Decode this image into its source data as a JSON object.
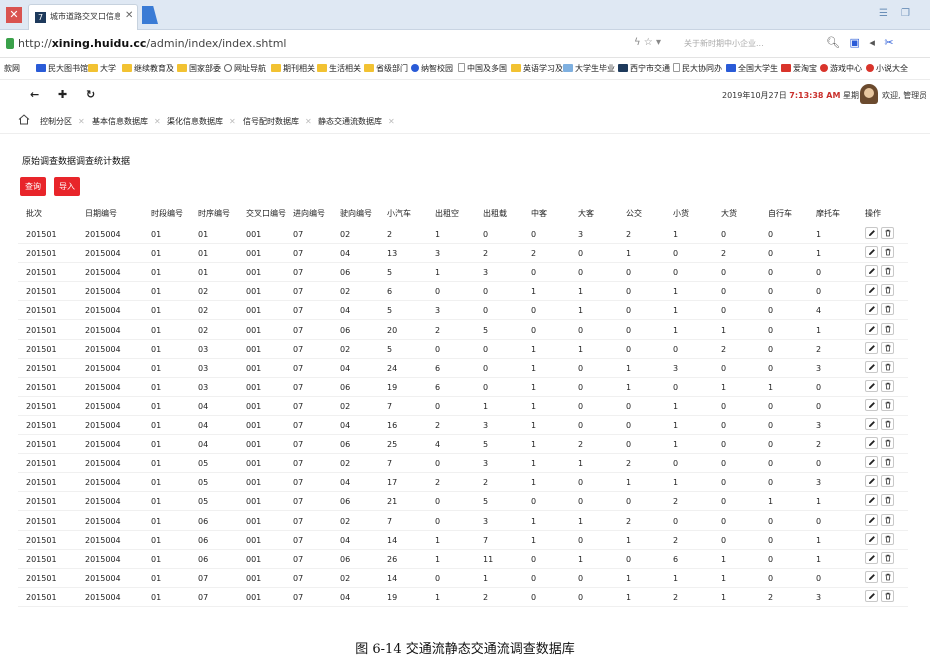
{
  "browser": {
    "tab_title": "城市道路交叉口信息采集",
    "url_prefix": "http://",
    "url_host": "xining.huidu.cc",
    "url_path": "/admin/index/index.shtml",
    "search_placeholder": "关于新时期中小企业..."
  },
  "bookmarks": [
    "款网",
    "民大图书馆",
    "大学",
    "继续教育及",
    "国家部委",
    "网址导航",
    "期刊相关",
    "生活相关",
    "省级部门",
    "纳智校园",
    "中国及多国",
    "英语学习及",
    "大学生毕业",
    "西宁市交通",
    "民大协同办",
    "全国大学生",
    "爱淘宝",
    "游戏中心",
    "小说大全"
  ],
  "header": {
    "date": "2019年10月27日",
    "time": "7:13:38 AM",
    "weekday": "星期日",
    "welcome": "欢迎, 管理员"
  },
  "module_tabs": [
    "控制分区",
    "基本信息数据库",
    "渠化信息数据库",
    "信号配时数据库",
    "静态交通流数据库"
  ],
  "sub_tabs": [
    "原始调查数据",
    "调查统计数据"
  ],
  "buttons": {
    "query": "查询",
    "import": "导入"
  },
  "columns": [
    "批次",
    "日期编号",
    "时段编号",
    "时序编号",
    "交叉口编号",
    "进向编号",
    "驶向编号",
    "小汽车",
    "出租空",
    "出租载",
    "中客",
    "大客",
    "公交",
    "小货",
    "大货",
    "自行车",
    "摩托车",
    "操作"
  ],
  "rows": [
    [
      "201501",
      "2015004",
      "01",
      "01",
      "001",
      "07",
      "02",
      "2",
      "1",
      "0",
      "0",
      "3",
      "2",
      "1",
      "0",
      "0",
      "1"
    ],
    [
      "201501",
      "2015004",
      "01",
      "01",
      "001",
      "07",
      "04",
      "13",
      "3",
      "2",
      "2",
      "0",
      "1",
      "0",
      "2",
      "0",
      "1"
    ],
    [
      "201501",
      "2015004",
      "01",
      "01",
      "001",
      "07",
      "06",
      "5",
      "1",
      "3",
      "0",
      "0",
      "0",
      "0",
      "0",
      "0",
      "0"
    ],
    [
      "201501",
      "2015004",
      "01",
      "02",
      "001",
      "07",
      "02",
      "6",
      "0",
      "0",
      "1",
      "1",
      "0",
      "1",
      "0",
      "0",
      "0"
    ],
    [
      "201501",
      "2015004",
      "01",
      "02",
      "001",
      "07",
      "04",
      "5",
      "3",
      "0",
      "0",
      "1",
      "0",
      "1",
      "0",
      "0",
      "4"
    ],
    [
      "201501",
      "2015004",
      "01",
      "02",
      "001",
      "07",
      "06",
      "20",
      "2",
      "5",
      "0",
      "0",
      "0",
      "1",
      "1",
      "0",
      "1"
    ],
    [
      "201501",
      "2015004",
      "01",
      "03",
      "001",
      "07",
      "02",
      "5",
      "0",
      "0",
      "1",
      "1",
      "0",
      "0",
      "2",
      "0",
      "2"
    ],
    [
      "201501",
      "2015004",
      "01",
      "03",
      "001",
      "07",
      "04",
      "24",
      "6",
      "0",
      "1",
      "0",
      "1",
      "3",
      "0",
      "0",
      "3"
    ],
    [
      "201501",
      "2015004",
      "01",
      "03",
      "001",
      "07",
      "06",
      "19",
      "6",
      "0",
      "1",
      "0",
      "1",
      "0",
      "1",
      "1",
      "0"
    ],
    [
      "201501",
      "2015004",
      "01",
      "04",
      "001",
      "07",
      "02",
      "7",
      "0",
      "1",
      "1",
      "0",
      "0",
      "1",
      "0",
      "0",
      "0"
    ],
    [
      "201501",
      "2015004",
      "01",
      "04",
      "001",
      "07",
      "04",
      "16",
      "2",
      "3",
      "1",
      "0",
      "0",
      "1",
      "0",
      "0",
      "3"
    ],
    [
      "201501",
      "2015004",
      "01",
      "04",
      "001",
      "07",
      "06",
      "25",
      "4",
      "5",
      "1",
      "2",
      "0",
      "1",
      "0",
      "0",
      "2"
    ],
    [
      "201501",
      "2015004",
      "01",
      "05",
      "001",
      "07",
      "02",
      "7",
      "0",
      "3",
      "1",
      "1",
      "2",
      "0",
      "0",
      "0",
      "0"
    ],
    [
      "201501",
      "2015004",
      "01",
      "05",
      "001",
      "07",
      "04",
      "17",
      "2",
      "2",
      "1",
      "0",
      "1",
      "1",
      "0",
      "0",
      "3"
    ],
    [
      "201501",
      "2015004",
      "01",
      "05",
      "001",
      "07",
      "06",
      "21",
      "0",
      "5",
      "0",
      "0",
      "0",
      "2",
      "0",
      "1",
      "1"
    ],
    [
      "201501",
      "2015004",
      "01",
      "06",
      "001",
      "07",
      "02",
      "7",
      "0",
      "3",
      "1",
      "1",
      "2",
      "0",
      "0",
      "0",
      "0"
    ],
    [
      "201501",
      "2015004",
      "01",
      "06",
      "001",
      "07",
      "04",
      "14",
      "1",
      "7",
      "1",
      "0",
      "1",
      "2",
      "0",
      "0",
      "1"
    ],
    [
      "201501",
      "2015004",
      "01",
      "06",
      "001",
      "07",
      "06",
      "26",
      "1",
      "11",
      "0",
      "1",
      "0",
      "6",
      "1",
      "0",
      "1"
    ],
    [
      "201501",
      "2015004",
      "01",
      "07",
      "001",
      "07",
      "02",
      "14",
      "0",
      "1",
      "0",
      "0",
      "1",
      "1",
      "1",
      "0",
      "0"
    ],
    [
      "201501",
      "2015004",
      "01",
      "07",
      "001",
      "07",
      "04",
      "19",
      "1",
      "2",
      "0",
      "0",
      "1",
      "2",
      "1",
      "2",
      "3"
    ]
  ],
  "caption": "图 6-14    交通流静态交通流调查数据库",
  "colors": {
    "accent_red": "#e8252a",
    "time_red": "#c9302c"
  },
  "icons": {
    "edit": "pencil-icon",
    "delete": "trash-icon"
  }
}
